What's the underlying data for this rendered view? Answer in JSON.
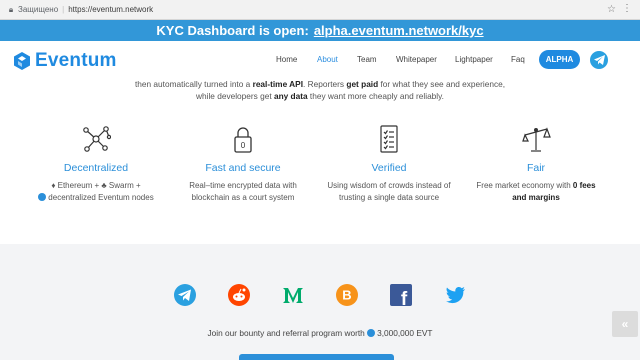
{
  "browser": {
    "secure_label": "Защищено",
    "url": "https://eventum.network"
  },
  "banner": {
    "text": "KYC Dashboard is open:",
    "link": "alpha.eventum.network/kyc"
  },
  "header": {
    "brand": "Eventum",
    "nav": [
      "Home",
      "About",
      "Team",
      "Whitepaper",
      "Lightpaper",
      "Faq"
    ],
    "active_nav": "About",
    "alpha_button": "ALPHA"
  },
  "intro": {
    "line1_a": "then automatically turned into a ",
    "line1_b": "real-time API",
    "line1_c": ". Reporters ",
    "line1_d": "get paid",
    "line1_e": " for what they see and experience,",
    "line2_a": "while developers get ",
    "line2_b": "any data",
    "line2_c": " they want more cheaply and reliably."
  },
  "features": [
    {
      "icon": "network-nodes-icon",
      "title": "Decentralized",
      "line1": "♦ Ethereum + ♣ Swarm +",
      "line2": "decentralized Eventum nodes"
    },
    {
      "icon": "padlock-icon",
      "title": "Fast and secure",
      "line1": "Real–time encrypted data with",
      "line2": "blockchain as a court system"
    },
    {
      "icon": "checklist-icon",
      "title": "Verified",
      "line1": "Using wisdom of crowds instead of",
      "line2": "trusting a single data source"
    },
    {
      "icon": "scales-icon",
      "title": "Fair",
      "line1_a": "Free market economy with ",
      "line1_b": "0 fees",
      "line2": "and margins"
    }
  ],
  "footer": {
    "socials": [
      "telegram-icon",
      "reddit-icon",
      "medium-icon",
      "bitcoin-icon",
      "facebook-icon",
      "twitter-icon"
    ],
    "bounty_text": "Join our bounty and referral program worth",
    "bounty_amount": "3,000,000 EVT",
    "scroll_top": "«"
  },
  "colors": {
    "brand_blue": "#1f8ae0",
    "banner_blue": "#3297d8",
    "footer_bg": "#f3f4f6"
  }
}
